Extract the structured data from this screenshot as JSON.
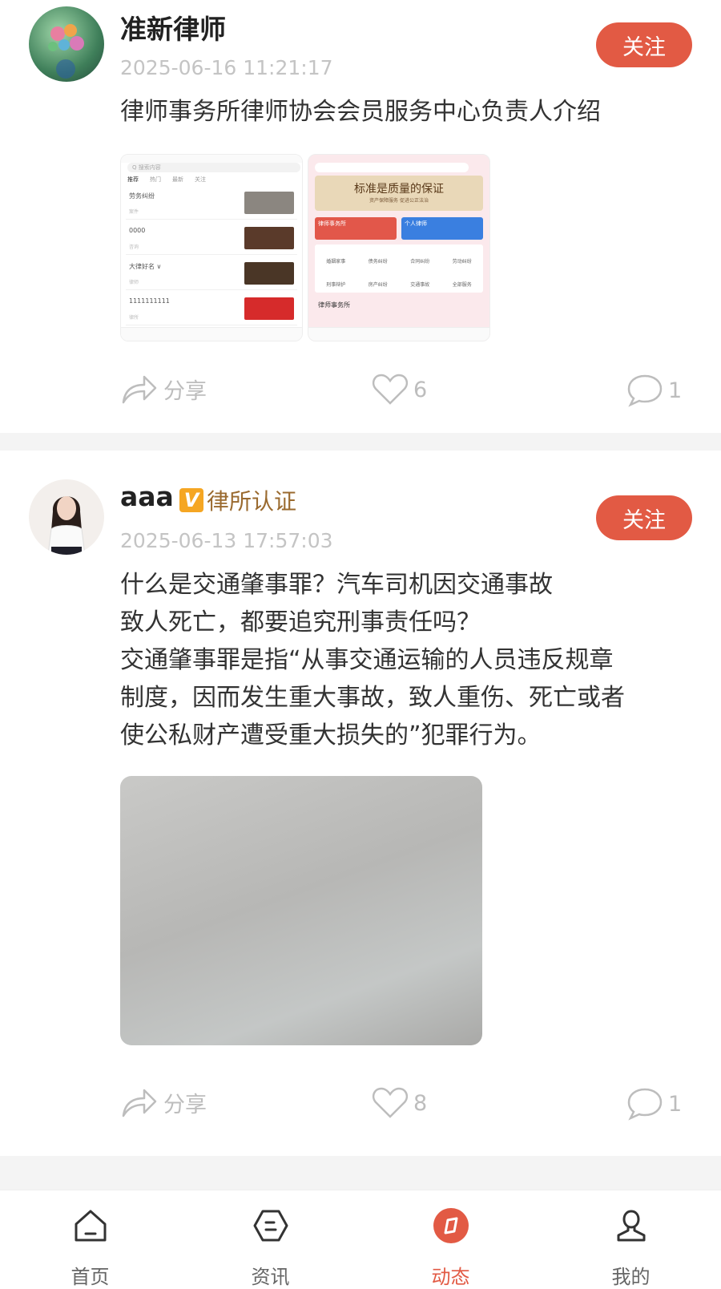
{
  "posts": [
    {
      "username": "准新律师",
      "time": "2025-06-16 11:21:17",
      "follow_label": "关注",
      "content": "律师事务所律师协会会员服务中心负责人介绍",
      "actions": {
        "share_label": "分享",
        "likes": "6",
        "comments": "1"
      },
      "thumb1": {
        "search": "Q 搜索内容",
        "tabs": [
          "推荐",
          "热门",
          "最新",
          "关注"
        ],
        "rows": [
          {
            "title": "劳务纠纷",
            "sub": "案件"
          },
          {
            "title": "0000",
            "sub": "咨询"
          },
          {
            "title": "大律好名 ∨",
            "sub": "律师"
          },
          {
            "title": "1111111111",
            "sub": "律所"
          }
        ]
      },
      "thumb2": {
        "banner": "标准是质量的保证",
        "banner_sub": "资产保障服务 促进公正法治",
        "card_a": "律师事务所",
        "card_b": "个人律师",
        "grid": [
          "婚姻家事",
          "债务纠纷",
          "合同纠纷",
          "劳动纠纷",
          "刑事辩护",
          "房产纠纷",
          "交通事故",
          "全部服务"
        ],
        "footer": "律师事务所"
      }
    },
    {
      "username": "aaa",
      "badge_v": "V",
      "badge": "律所认证",
      "time": "2025-06-13 17:57:03",
      "follow_label": "关注",
      "content": "什么是交通肇事罪？汽车司机因交通事故\n致人死亡，都要追究刑事责任吗？\n交通肇事罪是指“从事交通运输的人员违反规章\n制度，因而发生重大事故，致人重伤、死亡或者\n使公私财产遭受重大损失的”犯罪行为。",
      "actions": {
        "share_label": "分享",
        "likes": "8",
        "comments": "1"
      }
    }
  ],
  "tabbar": [
    {
      "label": "首页",
      "icon": "home-icon",
      "active": false
    },
    {
      "label": "资讯",
      "icon": "news-icon",
      "active": false
    },
    {
      "label": "动态",
      "icon": "moments-icon",
      "active": true
    },
    {
      "label": "我的",
      "icon": "profile-icon",
      "active": false
    }
  ],
  "colors": {
    "accent": "#e25a44",
    "muted": "#bdbdbd",
    "divider": "#f4f4f4",
    "badge": "#f5a623"
  }
}
